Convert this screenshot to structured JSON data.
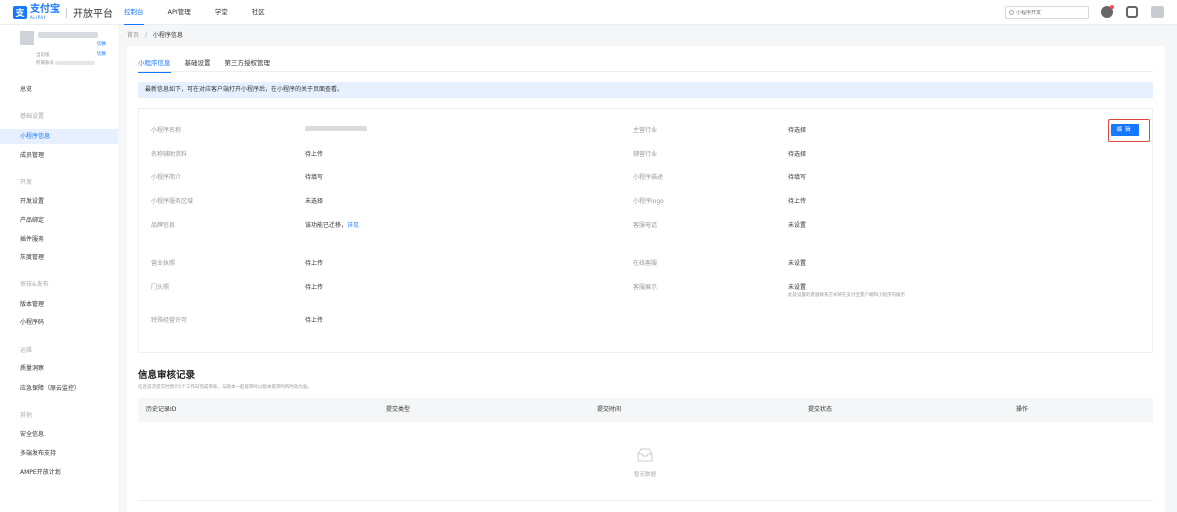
{
  "header": {
    "logo_mark": "支",
    "logo_cn": "支付宝",
    "logo_en": "ALIPAY",
    "platform_title": "开放平台",
    "nav": [
      "控制台",
      "API管理",
      "学堂",
      "社区"
    ],
    "search_placeholder": "小程序开发"
  },
  "account": {
    "switch1": "切换",
    "switch2": "切换",
    "label1": "当前版",
    "label2": "所属账号"
  },
  "sidebar": {
    "items": [
      {
        "label": "总览",
        "type": "item"
      },
      {
        "label": "基础设置",
        "type": "group"
      },
      {
        "label": "小程序信息",
        "type": "active"
      },
      {
        "label": "成员管理",
        "type": "item"
      },
      {
        "label": "开发",
        "type": "group"
      },
      {
        "label": "开发设置",
        "type": "item"
      },
      {
        "label": "产品绑定",
        "type": "item"
      },
      {
        "label": "插件服务",
        "type": "item"
      },
      {
        "label": "灰度管理",
        "type": "item"
      },
      {
        "label": "审核&发布",
        "type": "group"
      },
      {
        "label": "版本管理",
        "type": "item"
      },
      {
        "label": "小程序码",
        "type": "item"
      },
      {
        "label": "运维",
        "type": "group"
      },
      {
        "label": "质量洞察",
        "type": "item"
      },
      {
        "label": "应急保障（原云监控）",
        "type": "item"
      },
      {
        "label": "其他",
        "type": "group"
      },
      {
        "label": "安全信息",
        "type": "item"
      },
      {
        "label": "多端发布支持",
        "type": "item"
      },
      {
        "label": "AMPE开放计划",
        "type": "item"
      }
    ]
  },
  "breadcrumb": {
    "home": "首页",
    "sep": "/",
    "current": "小程序信息"
  },
  "tabs": [
    "小程序信息",
    "基础设置",
    "第三方授权管理"
  ],
  "notice": "最新信息如下，可在对应客户端打开小程序后，在小程序的关于页面查看。",
  "fields_left": [
    {
      "label": "小程序名称",
      "value": ""
    },
    {
      "label": "名称辅助资料",
      "value": "待上传"
    },
    {
      "label": "小程序简介",
      "value": "待填写"
    },
    {
      "label": "小程序服务区域",
      "value": "未选择"
    },
    {
      "label": "品牌信息",
      "value": "该功能已迁移，",
      "link": "详见"
    },
    {
      "label": "营业执照",
      "value": "待上传"
    },
    {
      "label": "门头照",
      "value": "待上传"
    },
    {
      "label": "特殊经营许可",
      "value": "待上传"
    }
  ],
  "fields_right": [
    {
      "label": "主营行业",
      "value": "待选择"
    },
    {
      "label": "辅营行业",
      "value": "待选择"
    },
    {
      "label": "小程序描述",
      "value": "待填写"
    },
    {
      "label": "小程序logo",
      "value": "待上传"
    },
    {
      "label": "客服电话",
      "value": "未设置"
    },
    {
      "label": "在线客服",
      "value": "未设置"
    },
    {
      "label": "客服展示",
      "value": "未设置",
      "hint": "此处设置的客服联系方式将在支付宝客户端和小程序内展示"
    }
  ],
  "edit_button": "编辑",
  "audit": {
    "title": "信息审核记录",
    "subtitle": "信息首次提交时预计1个工作日完成审核，与版本一起提审时以版本提审时的时效为准。",
    "columns": [
      "历史记录ID",
      "提交类型",
      "提交时间",
      "提交状态",
      "操作"
    ],
    "empty_text": "暂无数据"
  }
}
